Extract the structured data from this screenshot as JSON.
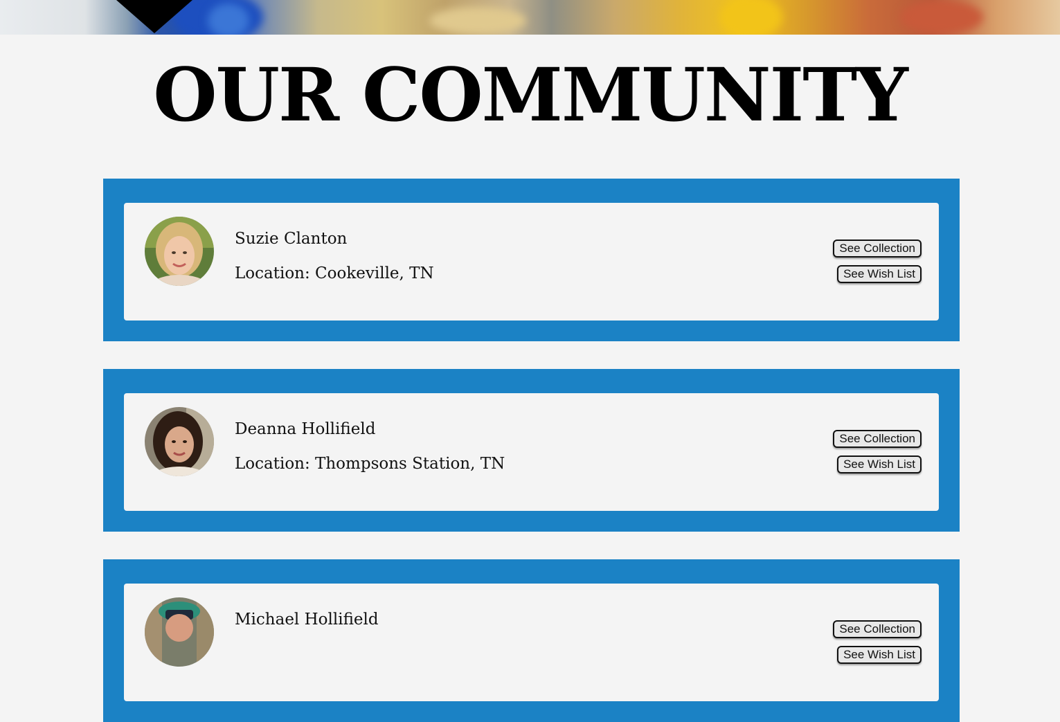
{
  "header": {
    "title": "OUR COMMUNITY"
  },
  "members": [
    {
      "name": "Suzie Clanton",
      "location": "Location: Cookeville, TN",
      "collection_label": "See Collection",
      "wishlist_label": "See Wish List"
    },
    {
      "name": "Deanna Hollifield",
      "location": "Location: Thompsons Station, TN",
      "collection_label": "See Collection",
      "wishlist_label": "See Wish List"
    },
    {
      "name": "Michael Hollifield",
      "location": "",
      "collection_label": "See Collection",
      "wishlist_label": "See Wish List"
    }
  ],
  "colors": {
    "card_border": "#1b82c5",
    "page_background": "#f4f4f4"
  }
}
